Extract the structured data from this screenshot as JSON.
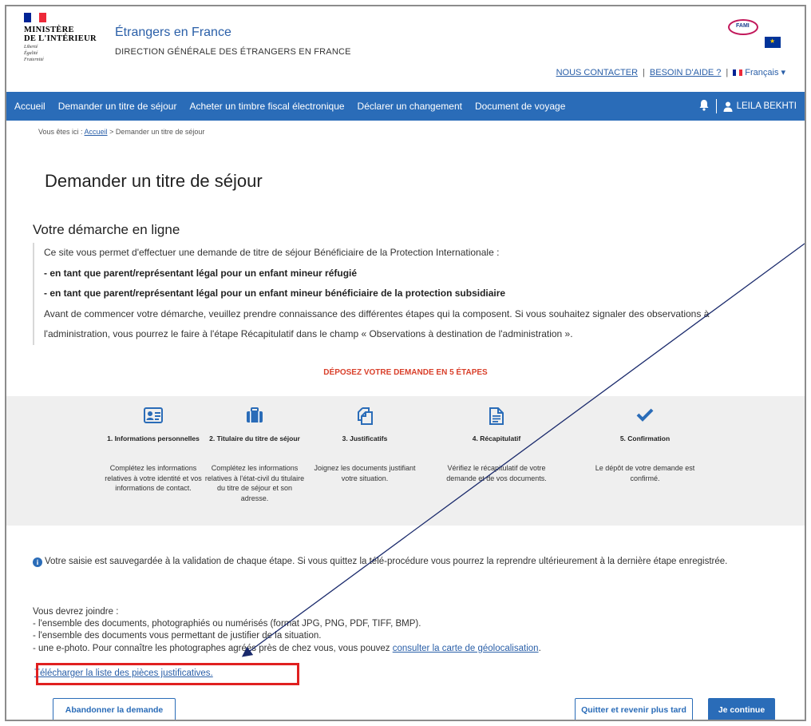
{
  "header": {
    "ministry_line1": "MINISTÈRE",
    "ministry_line2": "DE L'INTÉRIEUR",
    "motto": [
      "Liberté",
      "Égalité",
      "Fraternité"
    ],
    "site_title": "Étrangers en France",
    "site_subtitle": "DIRECTION GÉNÉRALE DES ÉTRANGERS EN FRANCE",
    "fami_logo_text": "FAMI",
    "links": {
      "contact": "NOUS CONTACTER",
      "help": "BESOIN D'AIDE ?",
      "language": "Français"
    }
  },
  "nav": {
    "items": [
      "Accueil",
      "Demander un titre de séjour",
      "Acheter un timbre fiscal électronique",
      "Déclarer un changement",
      "Document de voyage"
    ],
    "user_name": "LEILA BEKHTI"
  },
  "breadcrumb": {
    "prefix": "Vous êtes ici :",
    "home": "Accueil",
    "current": "> Demander un titre de séjour"
  },
  "page_title": "Demander un titre de séjour",
  "section": {
    "title": "Votre démarche en ligne",
    "intro": "Ce site vous permet d'effectuer une demande de titre de séjour Bénéficiaire de la Protection Internationale :",
    "bullet1": "- en tant que parent/représentant légal pour un enfant mineur réfugié",
    "bullet2": "- en tant que parent/représentant légal pour un enfant mineur bénéficiaire de la protection subsidiaire",
    "before_start": "Avant de commencer votre démarche, veuillez prendre connaissance des différentes étapes qui la composent. Si vous souhaitez signaler des observations à l'administration, vous pourrez le faire à l'étape Récapitulatif dans le champ « Observations à destination de l'administration »."
  },
  "steps_heading": "DÉPOSEZ VOTRE DEMANDE EN 5 ÉTAPES",
  "steps": [
    {
      "icon": "id-card-icon",
      "label": "1. Informations personnelles",
      "desc": "Complétez les informations relatives à votre identité et vos informations de contact."
    },
    {
      "icon": "suitcase-icon",
      "label": "2. Titulaire du titre de séjour",
      "desc": "Complétez les informations relatives à l'état-civil du titulaire du titre de séjour et son adresse."
    },
    {
      "icon": "copy-documents-icon",
      "label": "3. Justificatifs",
      "desc": "Joignez les documents justifiant votre situation."
    },
    {
      "icon": "document-icon",
      "label": "4. Récapitulatif",
      "desc": "Vérifiez le récapitulatif de votre demande et de vos documents."
    },
    {
      "icon": "checkmark-icon",
      "label": "5. Confirmation",
      "desc": "Le dépôt de votre demande est confirmé."
    }
  ],
  "info": "Votre saisie est sauvegardée à la validation de chaque étape. Si vous quittez la télé-procédure vous pourrez la reprendre ultérieurement à la dernière étape enregistrée.",
  "requirements": {
    "title": "Vous devrez joindre :",
    "line1": "- l'ensemble des documents, photographiés ou numérisés (format JPG, PNG, PDF, TIFF, BMP).",
    "line2": "- l'ensemble des documents vous permettant de justifier de la situation.",
    "line3_text": "- une e-photo. Pour connaître les photographes agréés près de chez vous, vous pouvez",
    "line3_link": "consulter la carte de géolocalisation",
    "line3_end": ".",
    "download_link": "Télécharger la liste des pièces justificatives."
  },
  "buttons": {
    "abandon": "Abandonner la demande",
    "later": "Quitter et revenir plus tard",
    "continue": "Je continue"
  },
  "colors": {
    "nav_blue": "#2a6cb8",
    "link_blue": "#2a5fa8",
    "heading_red": "#d9402b",
    "highlight_red": "#e02020",
    "band_gray": "#efefef"
  }
}
